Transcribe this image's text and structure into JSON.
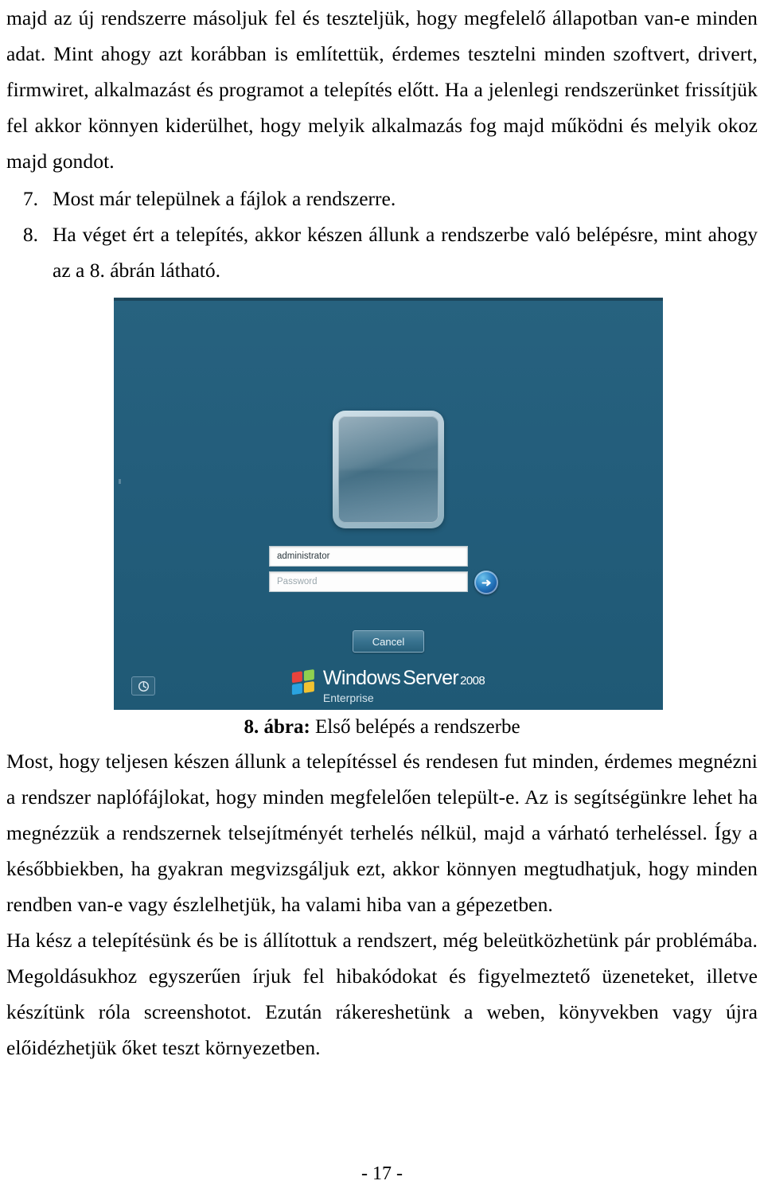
{
  "document": {
    "language": "hu",
    "page_number": "- 17 -"
  },
  "body": {
    "paragraph_1": "majd az új rendszerre másoljuk fel és teszteljük, hogy megfelelő állapotban van-e minden adat. Mint ahogy azt korábban is említettük, érdemes tesztelni minden szoftvert, drivert, firmwiret, alkalmazást és programot a telepítés előtt. Ha a jelenlegi rendszerünket frissítjük fel akkor könnyen kiderülhet, hogy melyik alkalmazás fog majd működni és melyik okoz majd gondot.",
    "list": [
      {
        "number": "7.",
        "text": "Most már települnek a fájlok a rendszerre."
      },
      {
        "number": "8.",
        "text": "Ha véget ért a telepítés, akkor készen állunk a rendszerbe való belépésre, mint ahogy az a 8. ábrán látható."
      }
    ],
    "paragraph_2": "Most, hogy teljesen készen állunk a telepítéssel és rendesen fut minden, érdemes megnézni a rendszer naplófájlokat, hogy minden megfelelően települt-e. Az is segítségünkre lehet ha megnézzük a rendszernek telsejítményét terhelés nélkül, majd a várható terheléssel. Így a későbbiekben, ha gyakran megvizsgáljuk ezt, akkor könnyen megtudhatjuk, hogy minden rendben van-e vagy észlelhetjük, ha valami hiba van a gépezetben.",
    "paragraph_3": "Ha kész a telepítésünk és be is állítottuk a rendszert, még beleütközhetünk pár problémába. Megoldásukhoz egyszerűen írjuk fel hibakódokat és figyelmeztető üzeneteket, illetve készítünk róla screenshotot. Ezután rákereshetünk a weben, könyvekben vagy újra előidézhetjük őket teszt környezetben."
  },
  "figure": {
    "caption_label": "8. ábra:",
    "caption_text": " Első belépés a rendszerbe",
    "screenshot": {
      "background_color": "#23607f",
      "user_tile": "user-account-picture",
      "username_field": {
        "value": "administrator",
        "name": "username-input"
      },
      "password_field": {
        "placeholder": "Password",
        "name": "password-input"
      },
      "submit_button_label": "→",
      "cancel_button_label": "Cancel",
      "power_button_label": "shutdown-options",
      "brand": {
        "product": "Windows",
        "server": "Server",
        "year": "2008",
        "edition": "Enterprise"
      }
    }
  }
}
